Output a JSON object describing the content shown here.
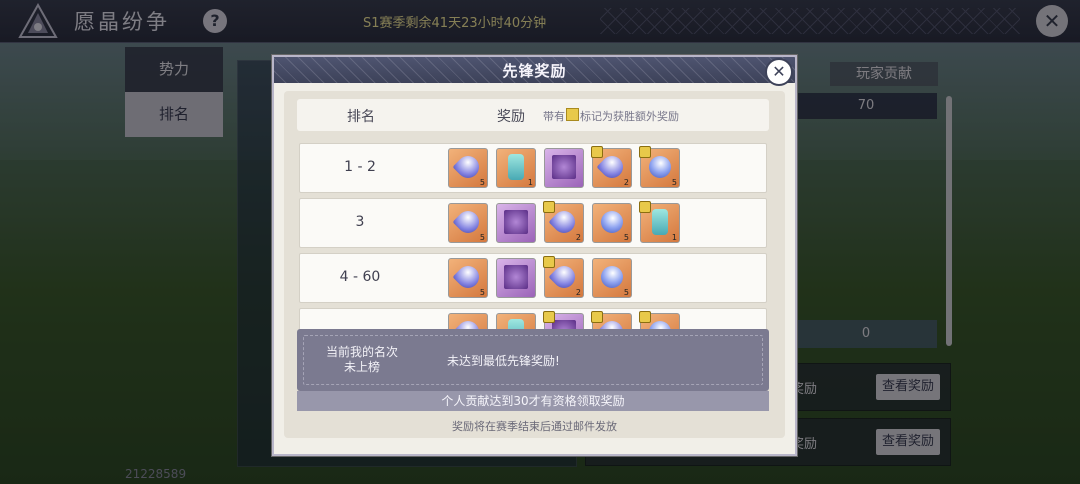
{
  "header": {
    "title": "愿晶纷争",
    "help_glyph": "?",
    "season_timer": "S1赛季剩余41天23小时40分钟",
    "close_glyph": "✕"
  },
  "tabs": [
    {
      "label": "势力",
      "active": false
    },
    {
      "label": "排名",
      "active": true
    }
  ],
  "background_panel": {
    "contribution_header": "玩家贡献",
    "contribution_top": "70",
    "contribution_mine": "0",
    "cards": [
      {
        "text": "奖励",
        "button": "查看奖励"
      },
      {
        "text": "奖励",
        "button": "查看奖励"
      }
    ],
    "uid": "21228589"
  },
  "modal": {
    "title": "先锋奖励",
    "close_glyph": "✕",
    "table_header": {
      "rank": "排名",
      "reward": "奖励",
      "note_prefix": "带有",
      "note_suffix": "标记为获胜额外奖励"
    },
    "rows": [
      {
        "rank": "1 - 2",
        "items": [
          {
            "kind": "orb",
            "bg": "orange",
            "count": "5",
            "bonus": false
          },
          {
            "kind": "lantern",
            "bg": "orange",
            "count": "1",
            "bonus": false
          },
          {
            "kind": "square",
            "bg": "purple",
            "count": "",
            "bonus": false
          },
          {
            "kind": "orb",
            "bg": "orange",
            "count": "2",
            "bonus": true
          },
          {
            "kind": "gem",
            "bg": "orange",
            "count": "5",
            "bonus": true
          }
        ]
      },
      {
        "rank": "3",
        "items": [
          {
            "kind": "orb",
            "bg": "orange",
            "count": "5",
            "bonus": false
          },
          {
            "kind": "square",
            "bg": "purple",
            "count": "",
            "bonus": false
          },
          {
            "kind": "orb",
            "bg": "orange",
            "count": "2",
            "bonus": true
          },
          {
            "kind": "gem",
            "bg": "orange",
            "count": "5",
            "bonus": false
          },
          {
            "kind": "lantern",
            "bg": "orange",
            "count": "1",
            "bonus": true
          }
        ]
      },
      {
        "rank": "4 - 60",
        "items": [
          {
            "kind": "orb",
            "bg": "orange",
            "count": "5",
            "bonus": false
          },
          {
            "kind": "square",
            "bg": "purple",
            "count": "",
            "bonus": false
          },
          {
            "kind": "orb",
            "bg": "orange",
            "count": "2",
            "bonus": true
          },
          {
            "kind": "gem",
            "bg": "orange",
            "count": "5",
            "bonus": false
          }
        ]
      },
      {
        "rank": "",
        "items": [
          {
            "kind": "orb",
            "bg": "orange",
            "count": "",
            "bonus": false
          },
          {
            "kind": "lantern",
            "bg": "orange",
            "count": "",
            "bonus": false
          },
          {
            "kind": "square",
            "bg": "purple",
            "count": "",
            "bonus": true
          },
          {
            "kind": "orb",
            "bg": "orange",
            "count": "",
            "bonus": true
          },
          {
            "kind": "gem",
            "bg": "orange",
            "count": "",
            "bonus": true
          }
        ]
      }
    ],
    "my_rank_label_line1": "当前我的名次",
    "my_rank_label_line2": "未上榜",
    "my_rank_message": "未达到最低先锋奖励!",
    "requirement": "个人贡献达到30才有资格领取奖励",
    "footer": "奖励将在赛季结束后通过邮件发放"
  }
}
